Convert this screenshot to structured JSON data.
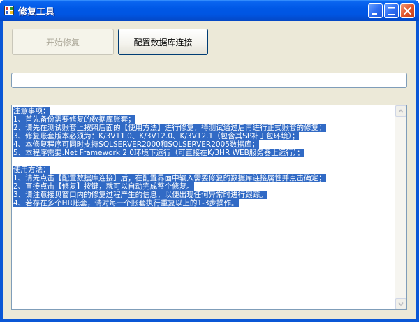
{
  "window": {
    "title": "修复工具",
    "icons": {
      "app": "app-icon",
      "minimize": "minimize-icon",
      "maximize": "maximize-icon",
      "close": "close-icon"
    }
  },
  "toolbar": {
    "start_label": "开始修复",
    "config_label": "配置数据库连接"
  },
  "progress": {
    "value": 0
  },
  "log_lines": [
    "注意事项：",
    "1、首先备份需要修复的数据库账套；",
    "2、请先在测试账套上按照后面的【使用方法】进行修复，待测试通过后再进行正式账套的修复；",
    "3、修复账套版本必须为：K/3V11.0、K/3V12.0、K/3V12.1（包含其SP补丁包环境）；",
    "4、本修复程序可同时支持SQLSERVER2000和SQLSERVER2005数据库；",
    "5、本程序需要.Net Framework 2.0环境下运行（可直接在K/3HR WEB服务器上运行）；",
    "",
    "使用方法：",
    "1、请先点击【配置数据库连接】后，在配置界面中输入需要修复的数据库连接属性并点击确定；",
    "2、直接点击【修复】按键，就可以自动完成整个修复。",
    "3、请注意接贝窗口内的修复过程产生的信息，以便出现任何异常时进行跟踪。",
    "4、若存在多个HR账套，请对每一个账套执行重复以上的1-3步操作。"
  ],
  "colors": {
    "selection": "#316ac5",
    "titlebar": "#0058e6",
    "client": "#ece9d8"
  }
}
